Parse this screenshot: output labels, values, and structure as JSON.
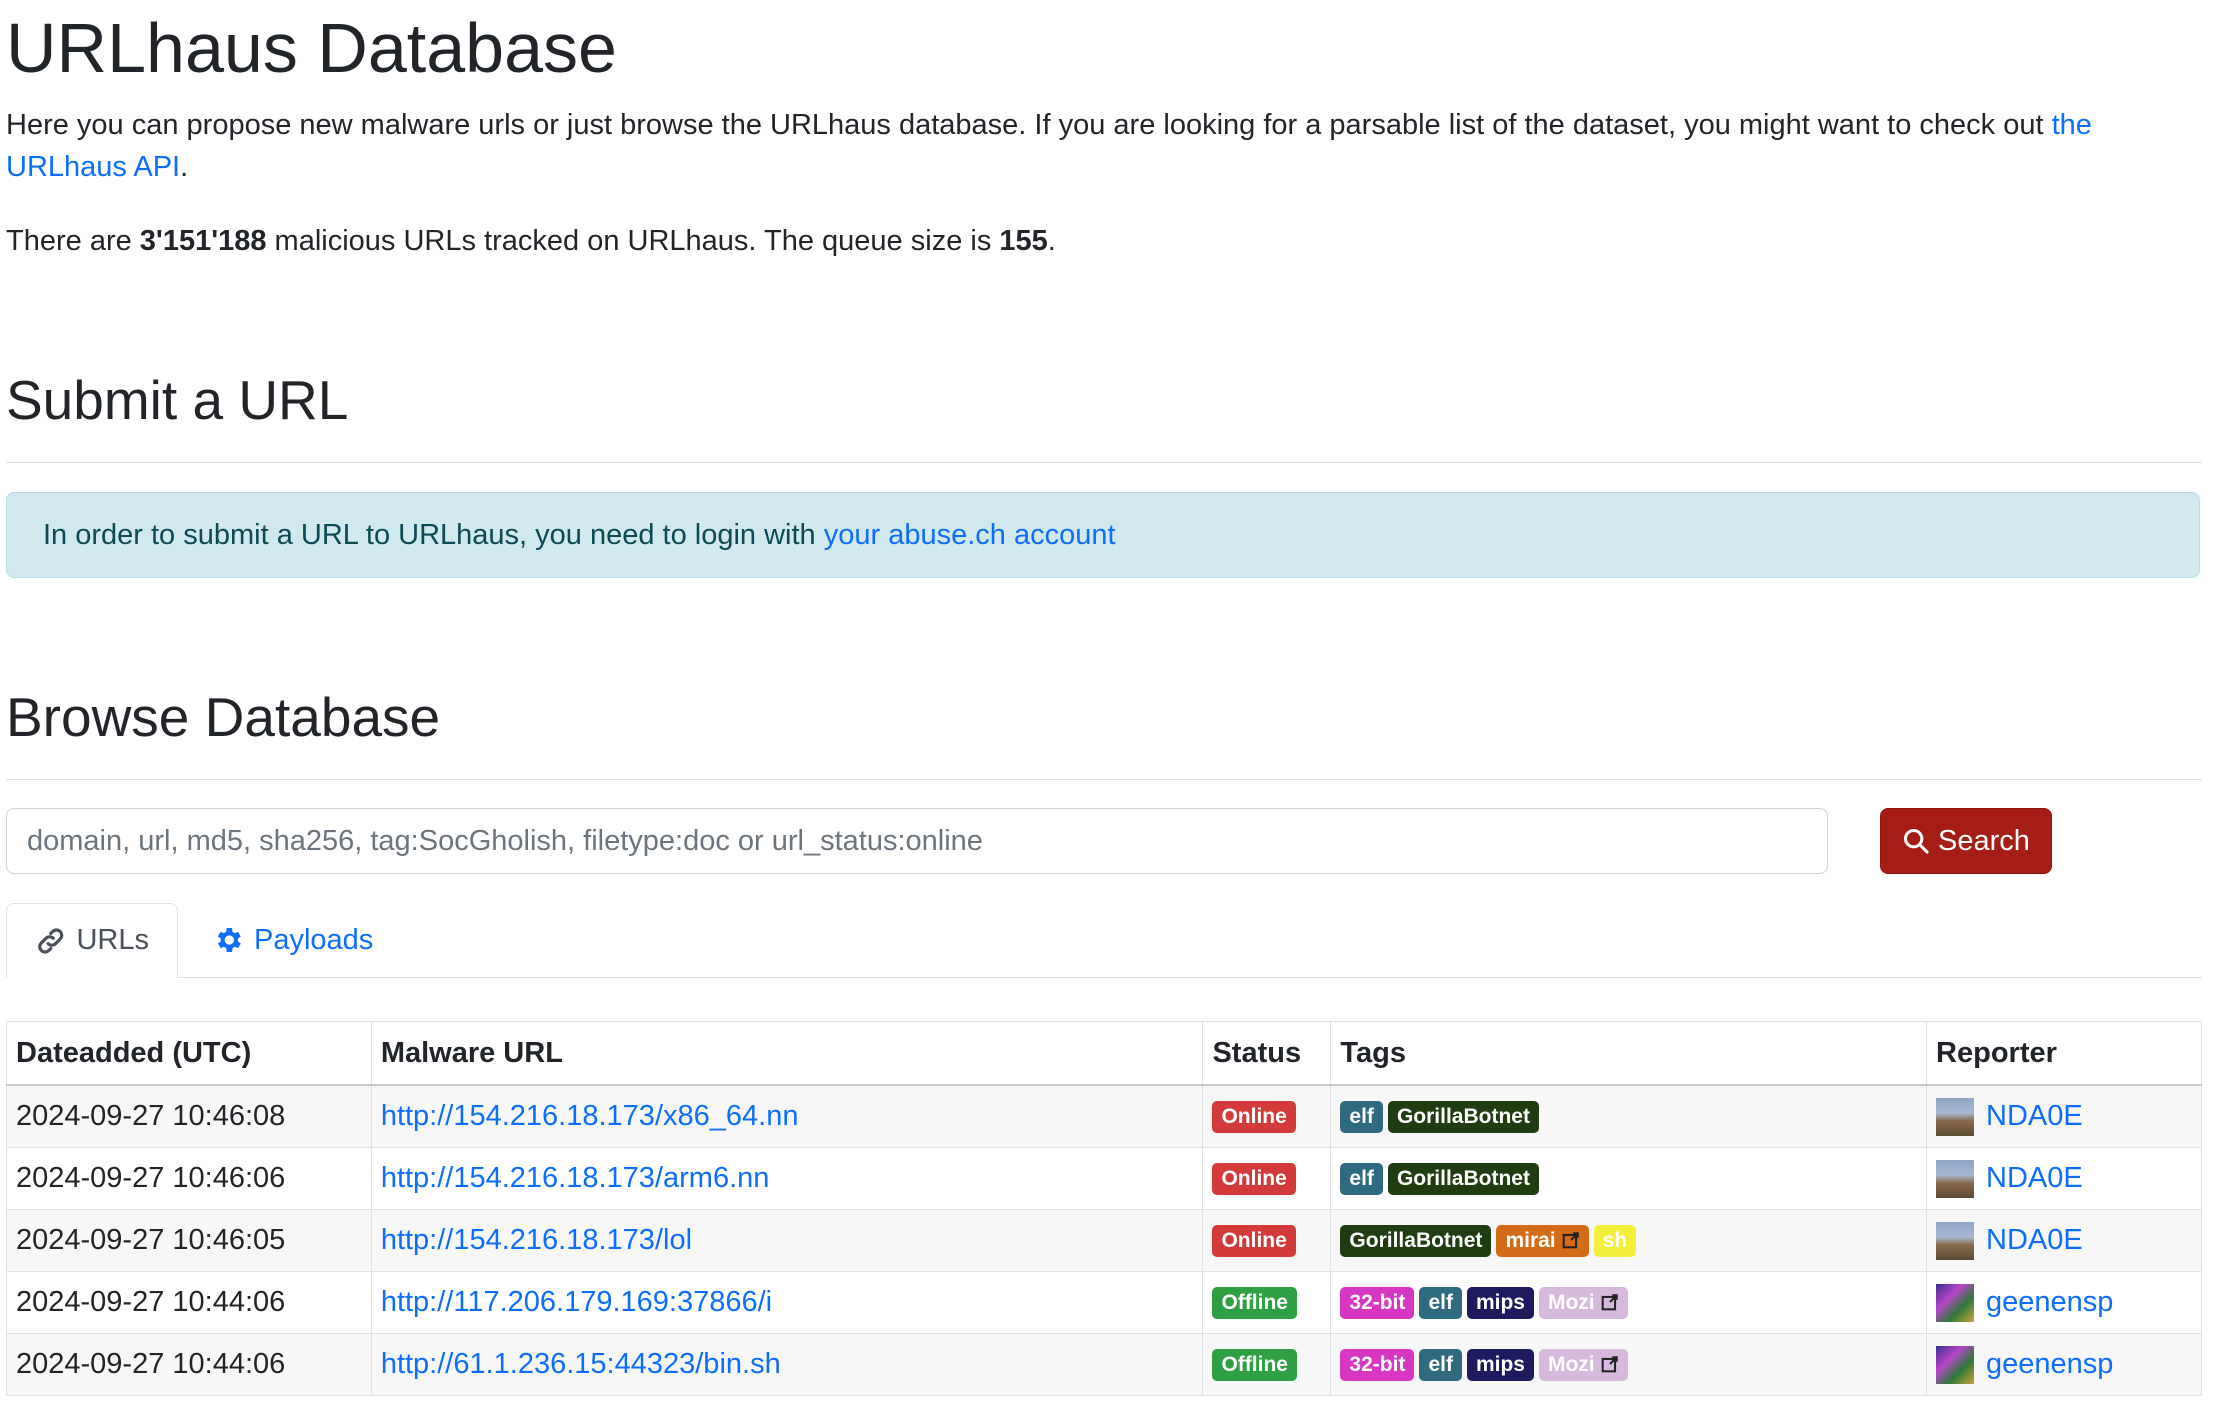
{
  "page": {
    "title": "URLhaus Database",
    "intro_text": "Here you can propose new malware urls or just browse the URLhaus database. If you are looking for a parsable list of the dataset, you might want to check out ",
    "intro_link": "the URLhaus API",
    "intro_end": ".",
    "stats_pre": "There are ",
    "stats_count": "3'151'188",
    "stats_mid": " malicious URLs tracked on URLhaus. The queue size is ",
    "stats_queue": "155",
    "stats_end": "."
  },
  "submit": {
    "heading": "Submit a URL",
    "alert_text": "In order to submit a URL to URLhaus, you need to login with ",
    "alert_link": "your abuse.ch account"
  },
  "browse": {
    "heading": "Browse Database",
    "search_placeholder": "domain, url, md5, sha256, tag:SocGholish, filetype:doc or url_status:online",
    "search_value": "",
    "search_button": "Search",
    "tabs": [
      {
        "label": "URLs",
        "icon": "link-icon",
        "active": true
      },
      {
        "label": "Payloads",
        "icon": "gear-icon",
        "active": false
      }
    ]
  },
  "table": {
    "headers": [
      "Dateadded (UTC)",
      "Malware URL",
      "Status",
      "Tags",
      "Reporter"
    ],
    "rows": [
      {
        "date": "2024-09-27 10:46:08",
        "url": "http://154.216.18.173/x86_64.nn",
        "status": "Online",
        "tags": [
          "elf",
          "GorillaBotnet"
        ],
        "reporter": "NDA0E"
      },
      {
        "date": "2024-09-27 10:46:06",
        "url": "http://154.216.18.173/arm6.nn",
        "status": "Online",
        "tags": [
          "elf",
          "GorillaBotnet"
        ],
        "reporter": "NDA0E"
      },
      {
        "date": "2024-09-27 10:46:05",
        "url": "http://154.216.18.173/lol",
        "status": "Online",
        "tags": [
          "GorillaBotnet",
          "mirai",
          "sh"
        ],
        "reporter": "NDA0E"
      },
      {
        "date": "2024-09-27 10:44:06",
        "url": "http://117.206.179.169:37866/i",
        "status": "Offline",
        "tags": [
          "32-bit",
          "elf",
          "mips",
          "Mozi"
        ],
        "reporter": "geenensp"
      },
      {
        "date": "2024-09-27 10:44:06",
        "url": "http://61.1.236.15:44323/bin.sh",
        "status": "Offline",
        "tags": [
          "32-bit",
          "elf",
          "mips",
          "Mozi"
        ],
        "reporter": "geenensp"
      }
    ]
  },
  "colors": {
    "link": "#0d6efd",
    "search_button": "#a51d14",
    "online": "#d33a3a",
    "offline": "#2ea043",
    "alert_bg": "#cfe9ee"
  }
}
